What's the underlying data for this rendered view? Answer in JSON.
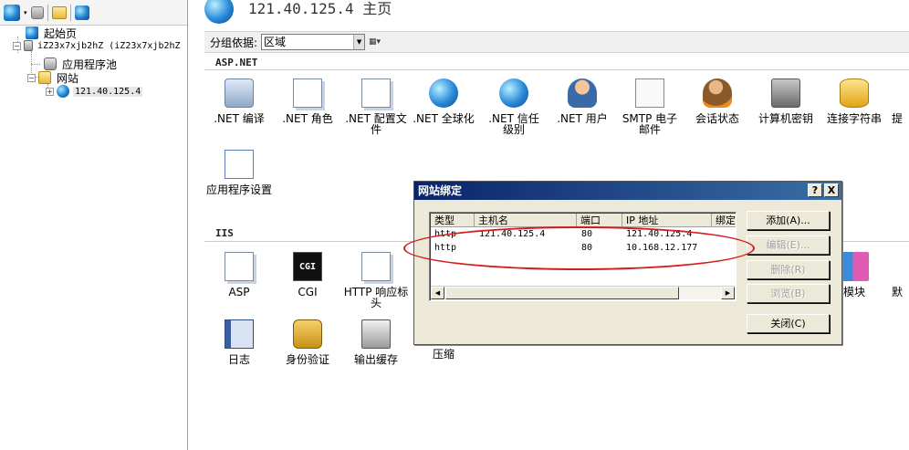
{
  "left_tree": {
    "items": [
      {
        "label": "起始页"
      },
      {
        "label": "iZ23x7xjb2hZ (iZ23x7xjb2hZ"
      },
      {
        "label": "应用程序池"
      },
      {
        "label": "网站"
      },
      {
        "label": "121.40.125.4"
      }
    ]
  },
  "header": {
    "title": "121.40.125.4 主页"
  },
  "groupbar": {
    "label": "分组依据:",
    "selected": "区域"
  },
  "sections": {
    "aspnet": "ASP.NET",
    "iis": "IIS"
  },
  "aspnet_features": [
    {
      "label": ".NET 编译",
      "icon": "compile-icon"
    },
    {
      "label": ".NET 角色",
      "icon": "roles-icon"
    },
    {
      "label": ".NET 配置文件",
      "icon": "profile-icon"
    },
    {
      "label": ".NET 全球化",
      "icon": "globalization-icon"
    },
    {
      "label": ".NET 信任级别",
      "icon": "trust-level-icon"
    },
    {
      "label": ".NET 用户",
      "icon": "users-icon"
    },
    {
      "label": "SMTP 电子邮件",
      "icon": "smtp-email-icon"
    },
    {
      "label": "会话状态",
      "icon": "session-state-icon"
    },
    {
      "label": "计算机密钥",
      "icon": "machine-key-icon"
    },
    {
      "label": "连接字符串",
      "icon": "connection-strings-icon"
    },
    {
      "label": "提",
      "icon": "providers-icon"
    },
    {
      "label": "应用程序设置",
      "icon": "app-settings-icon"
    }
  ],
  "iis_features": [
    {
      "label": "ASP",
      "icon": "asp-icon"
    },
    {
      "label": "CGI",
      "icon": "cgi-icon"
    },
    {
      "label": "HTTP 响应标头",
      "icon": "http-headers-icon"
    },
    {
      "label": "模块",
      "icon": "modules-icon"
    },
    {
      "label": "默",
      "icon": "default-document-icon"
    },
    {
      "label": "日志",
      "icon": "logging-icon"
    },
    {
      "label": "身份验证",
      "icon": "authentication-icon"
    },
    {
      "label": "输出缓存",
      "icon": "output-cache-icon"
    },
    {
      "label": "压缩",
      "icon": "compression-icon"
    }
  ],
  "cgi_badge": "CGI",
  "dialog": {
    "title": "网站绑定",
    "help_btn": "?",
    "close_btn": "X",
    "columns": [
      "类型",
      "主机名",
      "端口",
      "IP 地址",
      "绑定"
    ],
    "rows": [
      {
        "type": "http",
        "host": "121.40.125.4",
        "port": "80",
        "ip": "121.40.125.4"
      },
      {
        "type": "http",
        "host": "",
        "port": "80",
        "ip": "10.168.12.177"
      }
    ],
    "buttons": {
      "add": "添加(A)...",
      "edit": "编辑(E)...",
      "remove": "删除(R)",
      "browse": "浏览(B)",
      "close": "关闭(C)"
    }
  },
  "colors": {
    "annotation": "#d41c1c",
    "dialog_title_bg": "#0a246a"
  }
}
